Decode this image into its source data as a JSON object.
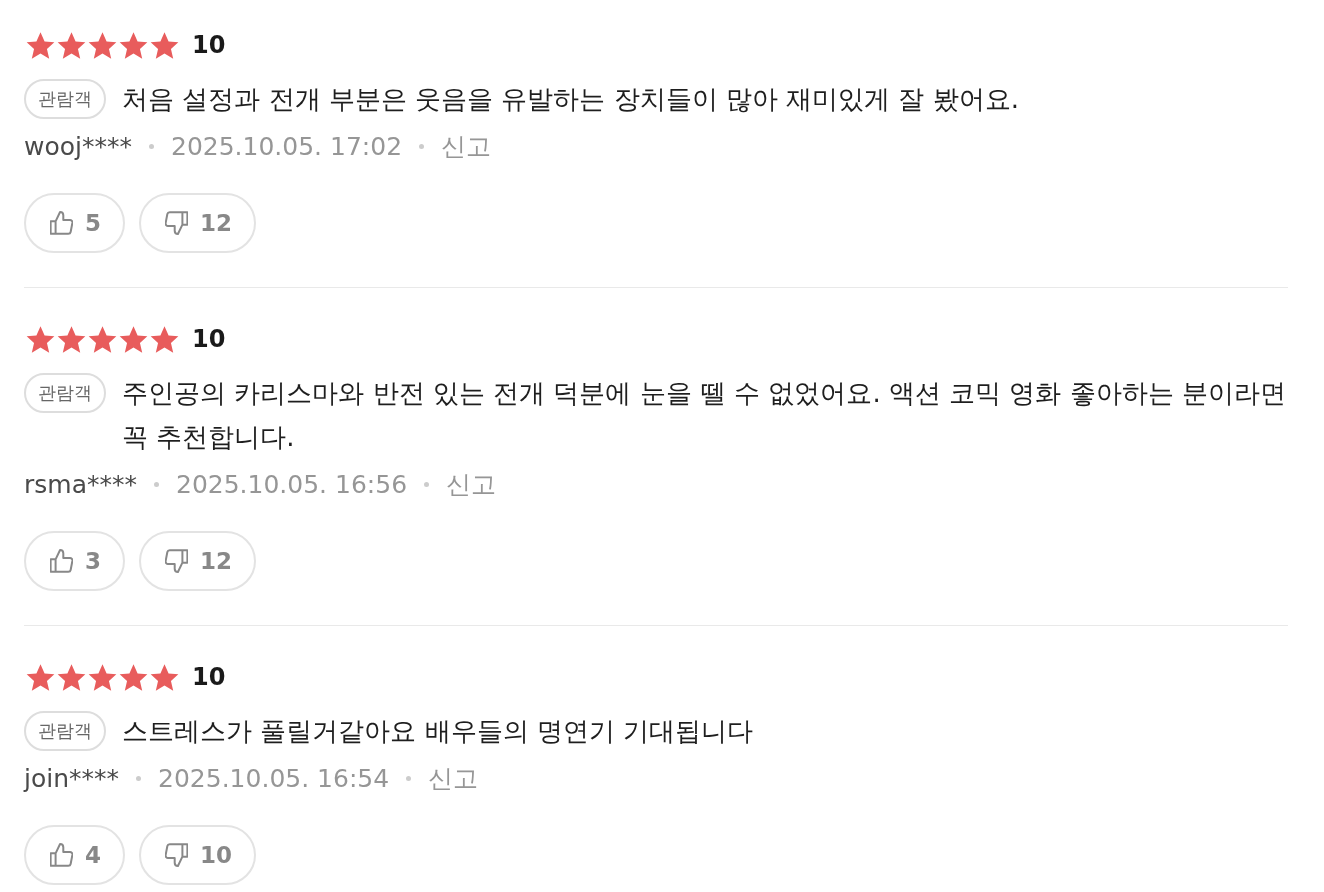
{
  "reviews": [
    {
      "stars": 5,
      "score": "10",
      "badge": "관람객",
      "text": "처음 설정과 전개 부분은 웃음을 유발하는 장치들이 많아 재미있게 잘 봤어요.",
      "author": "wooj****",
      "date": "2025.10.05. 17:02",
      "report": "신고",
      "likes": "5",
      "dislikes": "12"
    },
    {
      "stars": 5,
      "score": "10",
      "badge": "관람객",
      "text": "주인공의 카리스마와 반전 있는 전개 덕분에 눈을 뗄 수 없었어요. 액션 코믹 영화 좋아하는 분이라면 꼭 추천합니다.",
      "author": "rsma****",
      "date": "2025.10.05. 16:56",
      "report": "신고",
      "likes": "3",
      "dislikes": "12"
    },
    {
      "stars": 5,
      "score": "10",
      "badge": "관람객",
      "text": "스트레스가 풀릴거같아요 배우들의 명연기 기대됩니다",
      "author": "join****",
      "date": "2025.10.05. 16:54",
      "report": "신고",
      "likes": "4",
      "dislikes": "10"
    }
  ]
}
